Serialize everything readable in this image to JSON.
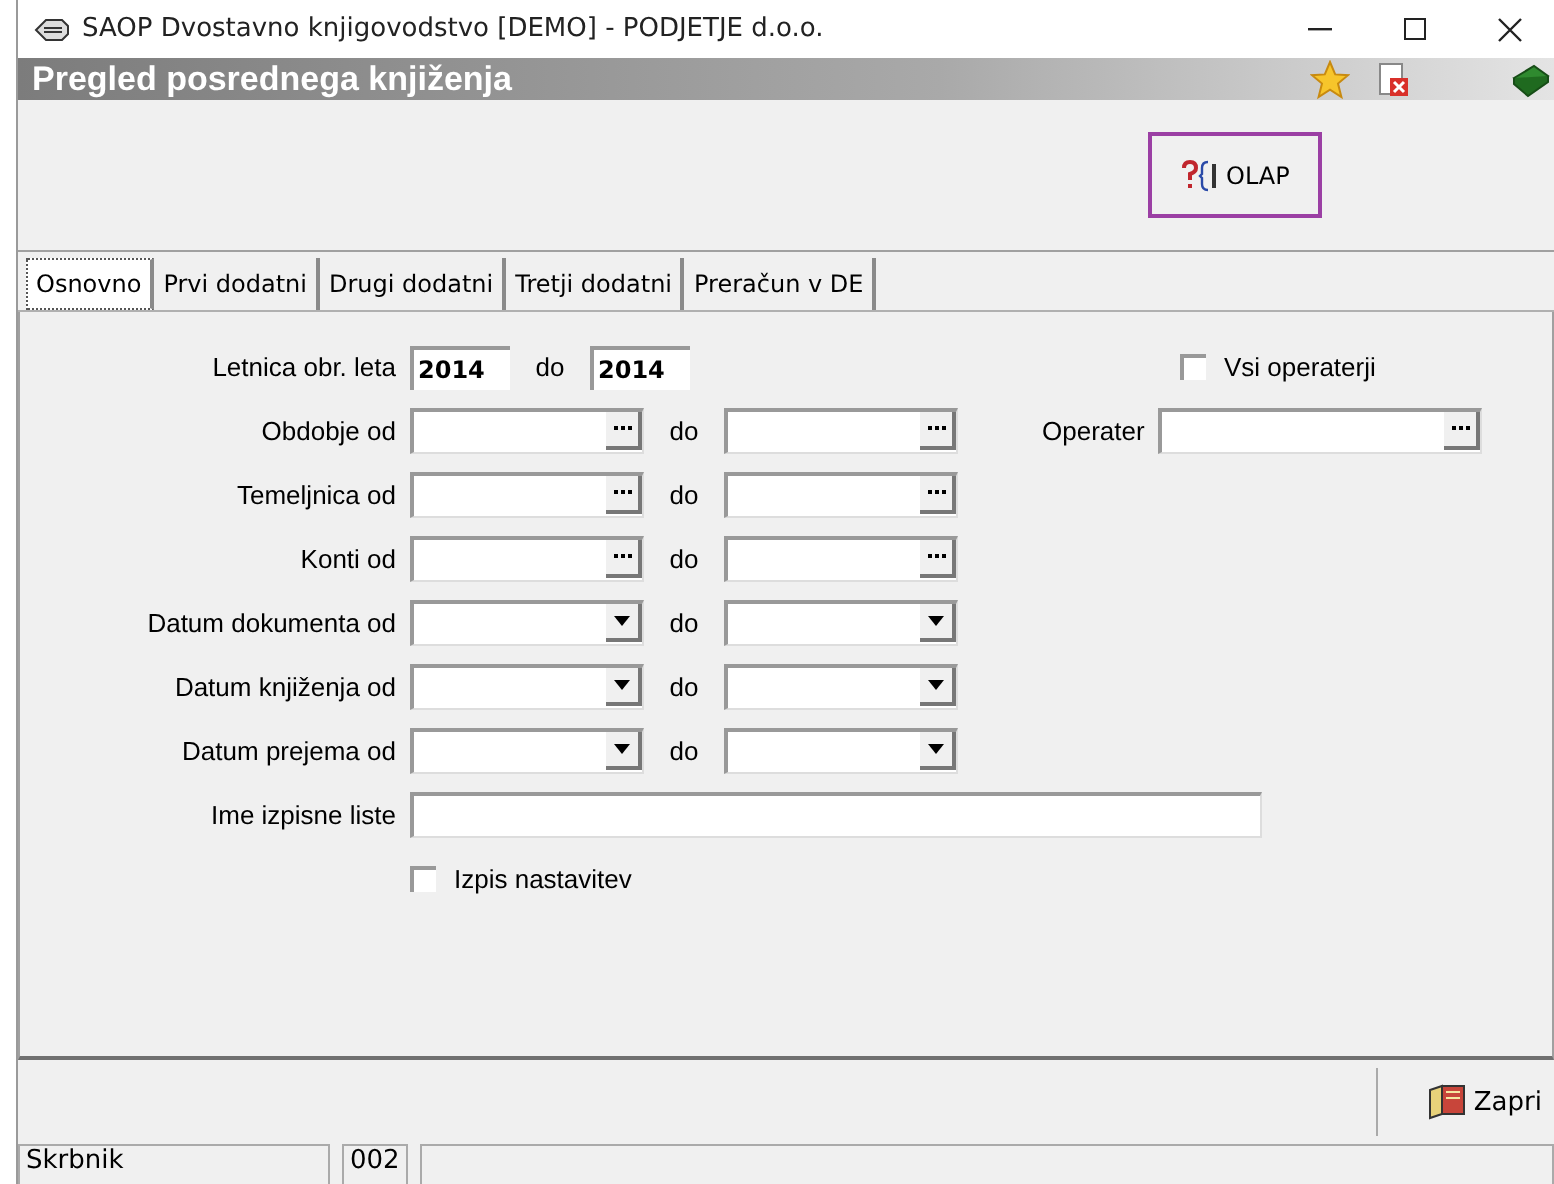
{
  "window": {
    "title": "SAOP  Dvostavno knjigovodstvo [DEMO] - PODJETJE d.o.o."
  },
  "form_title": "Pregled posrednega knjiženja",
  "olap_button": {
    "label": "OLAP",
    "highlighted": true
  },
  "tabs": [
    {
      "label": "Osnovno",
      "selected": true
    },
    {
      "label": "Prvi dodatni",
      "selected": false
    },
    {
      "label": "Drugi dodatni",
      "selected": false
    },
    {
      "label": "Tretji dodatni",
      "selected": false
    },
    {
      "label": "Preračun v DE",
      "selected": false
    }
  ],
  "year": {
    "label": "Letnica obr. leta",
    "from": "2014",
    "to_label": "do",
    "to": "2014"
  },
  "ranges": [
    {
      "label": "Obdobje od",
      "kind": "lookup",
      "to_label": "do"
    },
    {
      "label": "Temeljnica od",
      "kind": "lookup",
      "to_label": "do"
    },
    {
      "label": "Konti od",
      "kind": "lookup",
      "to_label": "do"
    },
    {
      "label": "Datum dokumenta od",
      "kind": "date",
      "to_label": "do"
    },
    {
      "label": "Datum knjiženja od",
      "kind": "date",
      "to_label": "do"
    },
    {
      "label": "Datum prejema od",
      "kind": "date",
      "to_label": "do"
    }
  ],
  "all_operators": {
    "label": "Vsi operaterji",
    "checked": false
  },
  "operator": {
    "label": "Operater"
  },
  "list_name": {
    "label": "Ime izpisne liste"
  },
  "print_settings": {
    "label": "Izpis nastavitev",
    "checked": false
  },
  "close_button": {
    "label": "Zapri"
  },
  "status_bar": [
    "Skrbnik",
    "002"
  ]
}
